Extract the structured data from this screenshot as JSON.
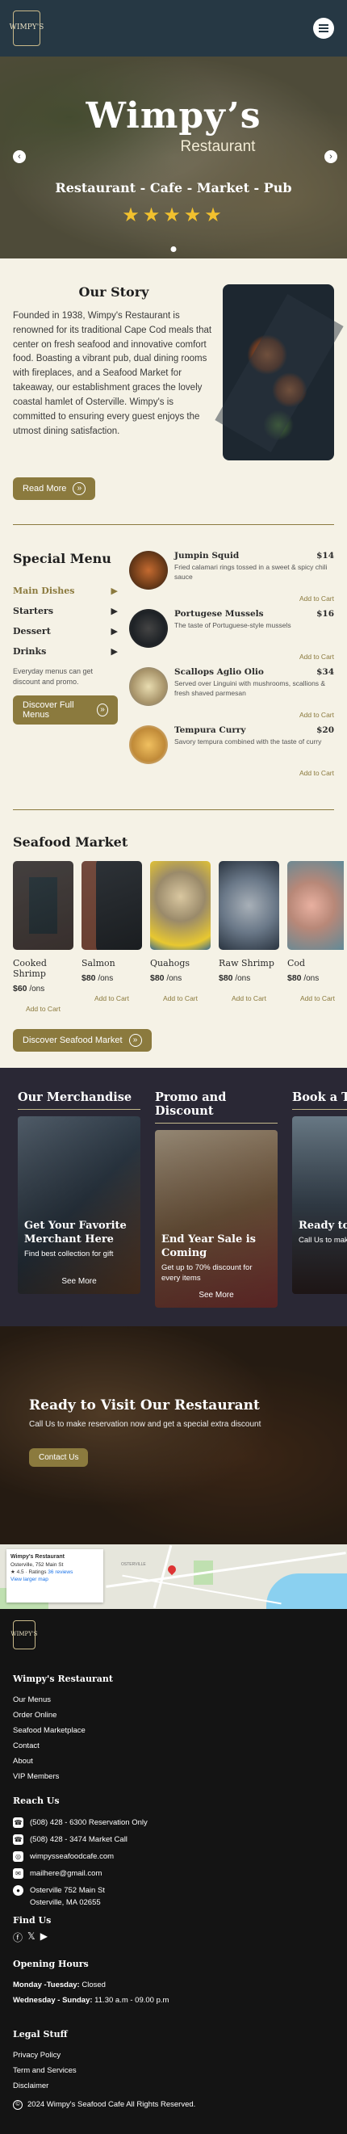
{
  "header": {
    "logo_text": "WIMPY'S",
    "menu_icon": "hamburger-icon"
  },
  "hero": {
    "title": "Wimpy’s",
    "subtitle": "Restaurant",
    "tagline": "Restaurant - Cafe - Market - Pub",
    "stars": "★★★★★",
    "prev": "‹",
    "next": "›"
  },
  "story": {
    "title": "Our Story",
    "text": "Founded in 1938, Wimpy's Restaurant is renowned for its traditional Cape Cod meals that center on fresh seafood and innovative comfort food. Boasting a vibrant pub, dual dining rooms with fireplaces, and a Seafood Market for takeaway, our establishment graces the lovely coastal hamlet of Osterville. Wimpy's is committed to ensuring every guest enjoys the utmost dining satisfaction.",
    "button": "Read More"
  },
  "menu": {
    "title": "Special Menu",
    "categories": [
      "Main Dishes",
      "Starters",
      "Dessert",
      "Drinks"
    ],
    "note": "Everyday menus can get discount and promo.",
    "button": "Discover Full Menus",
    "add_label": "Add to Cart",
    "dishes": [
      {
        "name": "Jumpin Squid",
        "price": "$14",
        "desc": "Fried calamari rings tossed in a sweet & spicy chili sauce"
      },
      {
        "name": "Portugese Mussels",
        "price": "$16",
        "desc": "The taste of Portuguese-style mussels"
      },
      {
        "name": "Scallops Aglio Olio",
        "price": "$34",
        "desc": "Served over Linguini with mushrooms, scallions & fresh shaved parmesan"
      },
      {
        "name": "Tempura Curry",
        "price": "$20",
        "desc": "Savory tempura combined with the taste of curry"
      }
    ]
  },
  "market": {
    "title": "Seafood Market",
    "button": "Discover Seafood Market",
    "add_label": "Add to Cart",
    "unit": "/ons",
    "products": [
      {
        "name": "Cooked Shrimp",
        "price": "$60"
      },
      {
        "name": "Salmon",
        "price": "$80"
      },
      {
        "name": "Quahogs",
        "price": "$80"
      },
      {
        "name": "Raw Shrimp",
        "price": "$80"
      },
      {
        "name": "Cod",
        "price": "$80"
      }
    ]
  },
  "promo": {
    "columns": [
      {
        "heading": "Our Merchandise",
        "card_title": "Get Your Favorite Merchant Here",
        "card_text": "Find best collection for gift",
        "link": "See More"
      },
      {
        "heading": "Promo and Discount",
        "card_title": "End Year Sale is Coming",
        "card_text": "Get up to 70% discount for every items",
        "link": "See More"
      },
      {
        "heading": "Book a Ta",
        "card_title": "Ready to J",
        "card_text": "Call Us to make Get an extra di",
        "link": "S"
      }
    ]
  },
  "visit": {
    "title": "Ready to Visit Our Restaurant",
    "text": "Call Us to make reservation now and get a special extra discount",
    "button": "Contact Us"
  },
  "map": {
    "place": "Wimpy's Restaurant",
    "address": "Osterville, 752 Main St",
    "rating": "4.5",
    "ratings_label": "★ 4.5 · Ratings",
    "reviews": "36 reviews",
    "larger_link": "View larger map",
    "label_osterville": "OSTERVILLE"
  },
  "footer": {
    "logo_text": "WIMPY'S",
    "brand_heading": "Wimpy's Restaurant",
    "links": [
      "Our Menus",
      "Order Online",
      "Seafood Marketplace",
      "Contact",
      "About",
      "VIP Members"
    ],
    "reach_heading": "Reach Us",
    "contacts": [
      {
        "icon": "phone-icon",
        "glyph": "☎",
        "text": "(508) 428 - 6300 Reservation Only"
      },
      {
        "icon": "phone-icon",
        "glyph": "☎",
        "text": "(508) 428 - 3474 Market Call"
      },
      {
        "icon": "globe-icon",
        "glyph": "◎",
        "text": "wimpysseafoodcafe.com"
      },
      {
        "icon": "mail-icon",
        "glyph": "✉",
        "text": "mailhere@gmail.com"
      },
      {
        "icon": "location-icon",
        "glyph": "●",
        "text": "Osterville 752 Main St\nOsterville, MA 02655"
      }
    ],
    "find_heading": "Find Us",
    "hours_heading": "Opening Hours",
    "hours": [
      {
        "day": "Monday -Tuesday:",
        "time": " Closed"
      },
      {
        "day": "Wednesday - Sunday:",
        "time": " 11.30 a.m - 09.00 p.m"
      }
    ],
    "legal_heading": "Legal Stuff",
    "legal": [
      "Privacy Policy",
      "Term and Services",
      "Disclaimer"
    ],
    "copyright": "2024 Wimpy's Seafood Cafe All Rights Reserved."
  },
  "colors": {
    "accent": "#8b7a3e",
    "header": "#263844",
    "dark": "#2a2835",
    "footer": "#141414",
    "background": "#f5f2e6"
  }
}
